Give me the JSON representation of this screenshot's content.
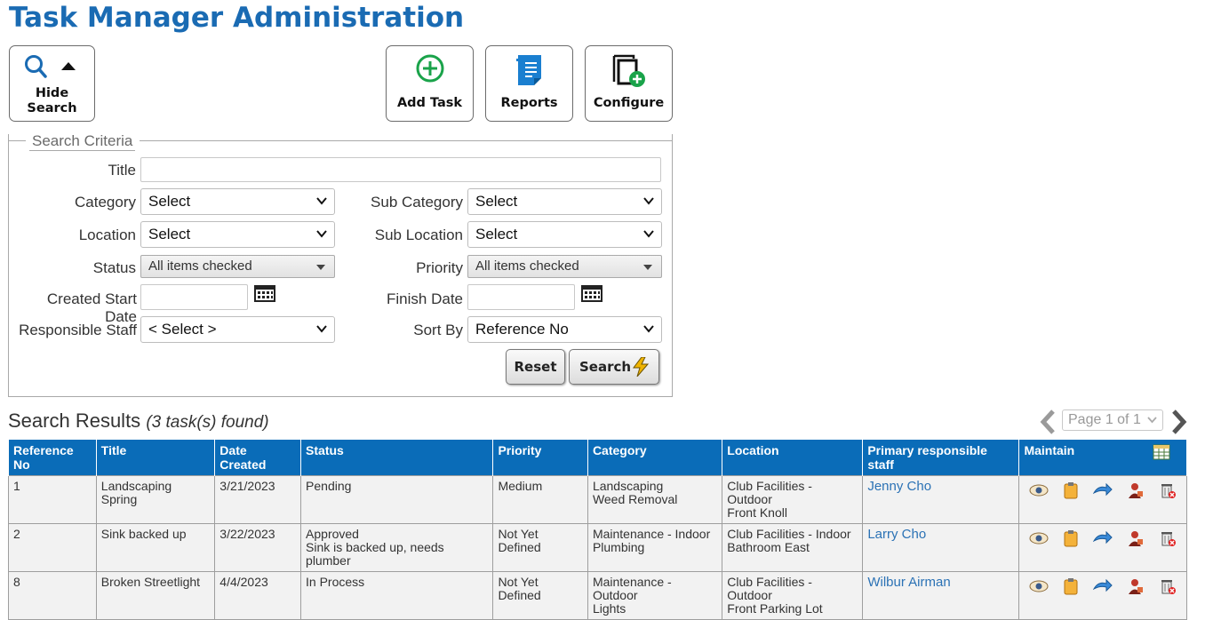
{
  "page": {
    "title": "Task Manager Administration"
  },
  "toolbar": {
    "hide_search_line1": "Hide",
    "hide_search_line2": "Search",
    "add_task": "Add Task",
    "reports": "Reports",
    "configure": "Configure"
  },
  "search": {
    "legend": "Search Criteria",
    "title_label": "Title",
    "title_value": "",
    "category_label": "Category",
    "category_value": "Select",
    "sub_category_label": "Sub Category",
    "sub_category_value": "Select",
    "location_label": "Location",
    "location_value": "Select",
    "sub_location_label": "Sub Location",
    "sub_location_value": "Select",
    "status_label": "Status",
    "status_value": "All items checked",
    "priority_label": "Priority",
    "priority_value": "All items checked",
    "created_start_label": "Created Start Date",
    "created_start_value": "",
    "finish_label": "Finish Date",
    "finish_value": "",
    "staff_label": "Responsible Staff",
    "staff_value": "< Select >",
    "sort_label": "Sort By",
    "sort_value": "Reference No",
    "reset_label": "Reset",
    "search_label": "Search"
  },
  "results": {
    "title": "Search Results",
    "count_text": "(3 task(s) found)",
    "page_text": "Page 1 of 1",
    "columns": [
      "Reference No",
      "Title",
      "Date Created",
      "Status",
      "Priority",
      "Category",
      "Location",
      "Primary responsible staff",
      "Maintain"
    ],
    "rows": [
      {
        "ref": "1",
        "title": "Landscaping Spring",
        "date": "3/21/2023",
        "status1": "Pending",
        "status2": "",
        "priority": "Medium",
        "cat1": "Landscaping",
        "cat2": "Weed Removal",
        "loc1": "Club Facilities - Outdoor",
        "loc2": "Front Knoll",
        "staff": "Jenny Cho"
      },
      {
        "ref": "2",
        "title": "Sink backed up",
        "date": "3/22/2023",
        "status1": "Approved",
        "status2": "Sink is backed up, needs plumber",
        "priority": "Not Yet Defined",
        "cat1": "Maintenance - Indoor",
        "cat2": "Plumbing",
        "loc1": "Club Facilities - Indoor",
        "loc2": "Bathroom East",
        "staff": "Larry Cho"
      },
      {
        "ref": "8",
        "title": "Broken Streetlight",
        "date": "4/4/2023",
        "status1": "In Process",
        "status2": "",
        "priority": "Not Yet Defined",
        "cat1": "Maintenance - Outdoor",
        "cat2": "Lights",
        "loc1": "Club Facilities - Outdoor",
        "loc2": "Front Parking Lot",
        "staff": "Wilbur Airman"
      }
    ]
  },
  "colors": {
    "brand": "#1a6bb3",
    "header_bg": "#0a6cb8",
    "add_green": "#1aa34a"
  }
}
